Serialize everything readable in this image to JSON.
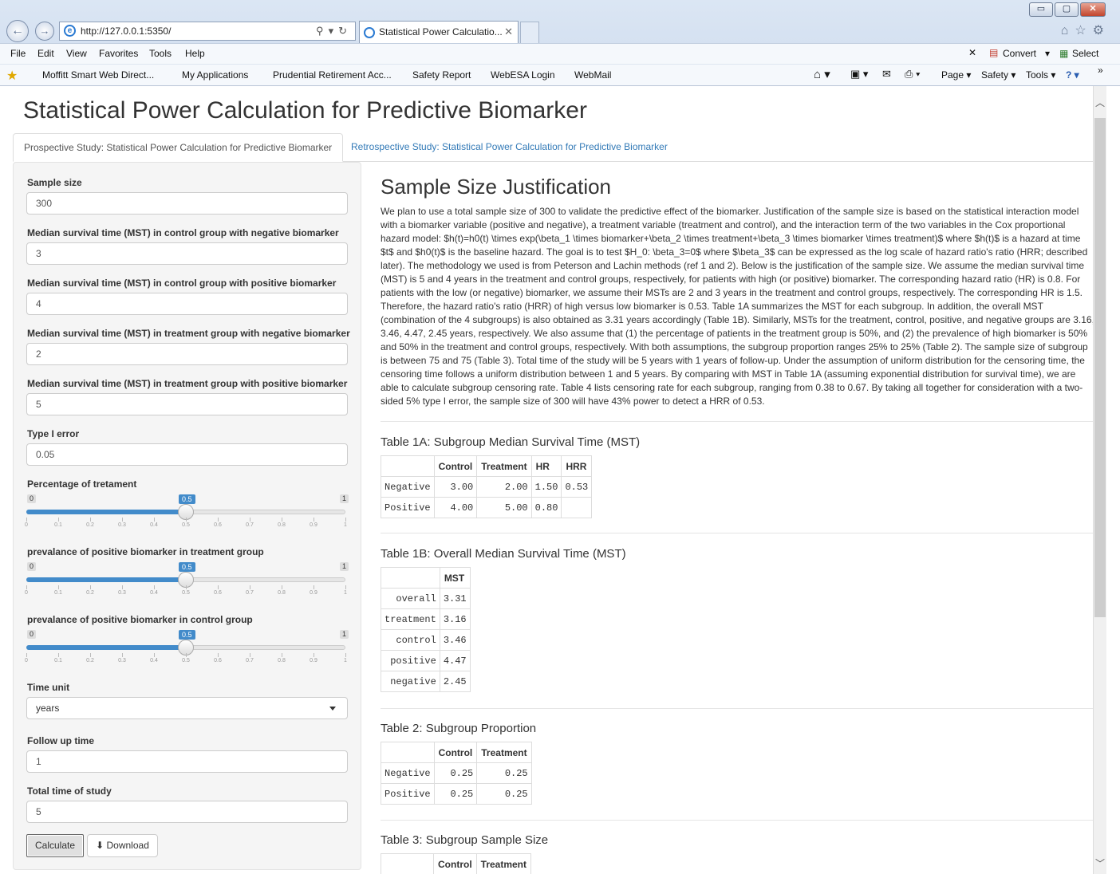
{
  "browser": {
    "window_controls": {
      "minimize": "▭",
      "maximize": "▢",
      "close": "✕"
    },
    "address": "http://127.0.0.1:5350/",
    "tab_title": "Statistical Power Calculatio...",
    "menu": [
      "File",
      "Edit",
      "View",
      "Favorites",
      "Tools",
      "Help"
    ],
    "convert_label": "Convert",
    "select_label": "Select",
    "favorites": [
      "Moffitt Smart Web Direct...",
      "My Applications",
      "Prudential Retirement Acc...",
      "Safety Report",
      "WebESA Login",
      "WebMail"
    ],
    "tools": [
      "Page",
      "Safety",
      "Tools"
    ]
  },
  "page": {
    "title": "Statistical Power Calculation for Predictive Biomarker",
    "tabs": [
      {
        "label": "Prospective Study: Statistical Power Calculation for Predictive Biomarker",
        "active": true
      },
      {
        "label": "Retrospective Study: Statistical Power Calculation for Predictive Biomarker",
        "active": false
      }
    ]
  },
  "sidebar": {
    "sample_size": {
      "label": "Sample size",
      "value": "300"
    },
    "mst_ctrl_neg": {
      "label": "Median survival time (MST) in control group with negative biomarker",
      "value": "3"
    },
    "mst_ctrl_pos": {
      "label": "Median survival time (MST) in control group with positive biomarker",
      "value": "4"
    },
    "mst_trt_neg": {
      "label": "Median survival time (MST) in treatment group with negative biomarker",
      "value": "2"
    },
    "mst_trt_pos": {
      "label": "Median survival time (MST) in treatment group with positive biomarker",
      "value": "5"
    },
    "type1": {
      "label": "Type I error",
      "value": "0.05"
    },
    "pct_treatment": {
      "label": "Percentage of tretament",
      "min": "0",
      "max": "1",
      "value": "0.5",
      "value_fraction": 0.5
    },
    "prev_trt": {
      "label": "prevalance of positive biomarker in treatment group",
      "min": "0",
      "max": "1",
      "value": "0.5",
      "value_fraction": 0.5
    },
    "prev_ctrl": {
      "label": "prevalance of positive biomarker in control group",
      "min": "0",
      "max": "1",
      "value": "0.5",
      "value_fraction": 0.5
    },
    "slider_ticks": [
      "0",
      "0.1",
      "0.2",
      "0.3",
      "0.4",
      "0.5",
      "0.6",
      "0.7",
      "0.8",
      "0.9",
      "1"
    ],
    "time_unit": {
      "label": "Time unit",
      "value": "years"
    },
    "follow_up": {
      "label": "Follow up time",
      "value": "1"
    },
    "total_time": {
      "label": "Total time of study",
      "value": "5"
    },
    "calculate_label": "Calculate",
    "download_label": "Download"
  },
  "main": {
    "justification_title": "Sample Size Justification",
    "justification_text": "We plan to use a total sample size of 300 to validate the predictive effect of the biomarker. Justification of the sample size is based on the statistical interaction model with a biomarker variable (positive and negative), a treatment variable (treatment and control), and the interaction term of the two variables in the Cox proportional hazard model: $h(t)=h0(t) \\times exp(\\beta_1 \\times biomarker+\\beta_2 \\times treatment+\\beta_3 \\times biomarker \\times treatment)$ where $h(t)$ is a hazard at time $t$ and $h0(t)$ is the baseline hazard. The goal is to test $H_0: \\beta_3=0$ where $\\beta_3$ can be expressed as the log scale of hazard ratio's ratio (HRR; described later). The methodology we used is from Peterson and Lachin methods (ref 1 and 2). Below is the justification of the sample size. We assume the median survival time (MST) is 5 and 4 years in the treatment and control groups, respectively, for patients with high (or positive) biomarker. The corresponding hazard ratio (HR) is 0.8. For patients with the low (or negative) biomarker, we assume their MSTs are 2 and 3 years in the treatment and control groups, respectively. The corresponding HR is 1.5. Therefore, the hazard ratio's ratio (HRR) of high versus low biomarker is 0.53. Table 1A summarizes the MST for each subgroup. In addition, the overall MST (combination of the 4 subgroups) is also obtained as 3.31 years accordingly (Table 1B). Similarly, MSTs for the treatment, control, positive, and negative groups are 3.16, 3.46, 4.47, 2.45 years, respectively. We also assume that (1) the percentage of patients in the treatment group is 50%, and (2) the prevalence of high biomarker is 50% and 50% in the treatment and control groups, respectively. With both assumptions, the subgroup proportion ranges 25% to 25% (Table 2). The sample size of subgroup is between 75 and 75 (Table 3). Total time of the study will be 5 years with 1 years of follow-up. Under the assumption of uniform distribution for the censoring time, the censoring time follows a uniform distribution between 1 and 5 years. By comparing with MST in Table 1A (assuming exponential distribution for survival time), we are able to calculate subgroup censoring rate. Table 4 lists censoring rate for each subgroup, ranging from 0.38 to 0.67. By taking all together for consideration with a two-sided 5% type I error, the sample size of 300 will have 43% power to detect a HRR of 0.53.",
    "table1a": {
      "title": "Table 1A: Subgroup Median Survival Time (MST)",
      "headers": [
        "",
        "Control",
        "Treatment",
        "HR",
        "HRR"
      ],
      "rows": [
        [
          "Negative",
          "3.00",
          "2.00",
          "1.50",
          "0.53"
        ],
        [
          "Positive",
          "4.00",
          "5.00",
          "0.80",
          ""
        ]
      ]
    },
    "table1b": {
      "title": "Table 1B: Overall Median Survival Time (MST)",
      "headers": [
        "",
        "MST"
      ],
      "rows": [
        [
          "overall",
          "3.31"
        ],
        [
          "treatment",
          "3.16"
        ],
        [
          "control",
          "3.46"
        ],
        [
          "positive",
          "4.47"
        ],
        [
          "negative",
          "2.45"
        ]
      ]
    },
    "table2": {
      "title": "Table 2: Subgroup Proportion",
      "headers": [
        "",
        "Control",
        "Treatment"
      ],
      "rows": [
        [
          "Negative",
          "0.25",
          "0.25"
        ],
        [
          "Positive",
          "0.25",
          "0.25"
        ]
      ]
    },
    "table3": {
      "title": "Table 3: Subgroup Sample Size",
      "headers": [
        "",
        "Control",
        "Treatment"
      ]
    }
  }
}
